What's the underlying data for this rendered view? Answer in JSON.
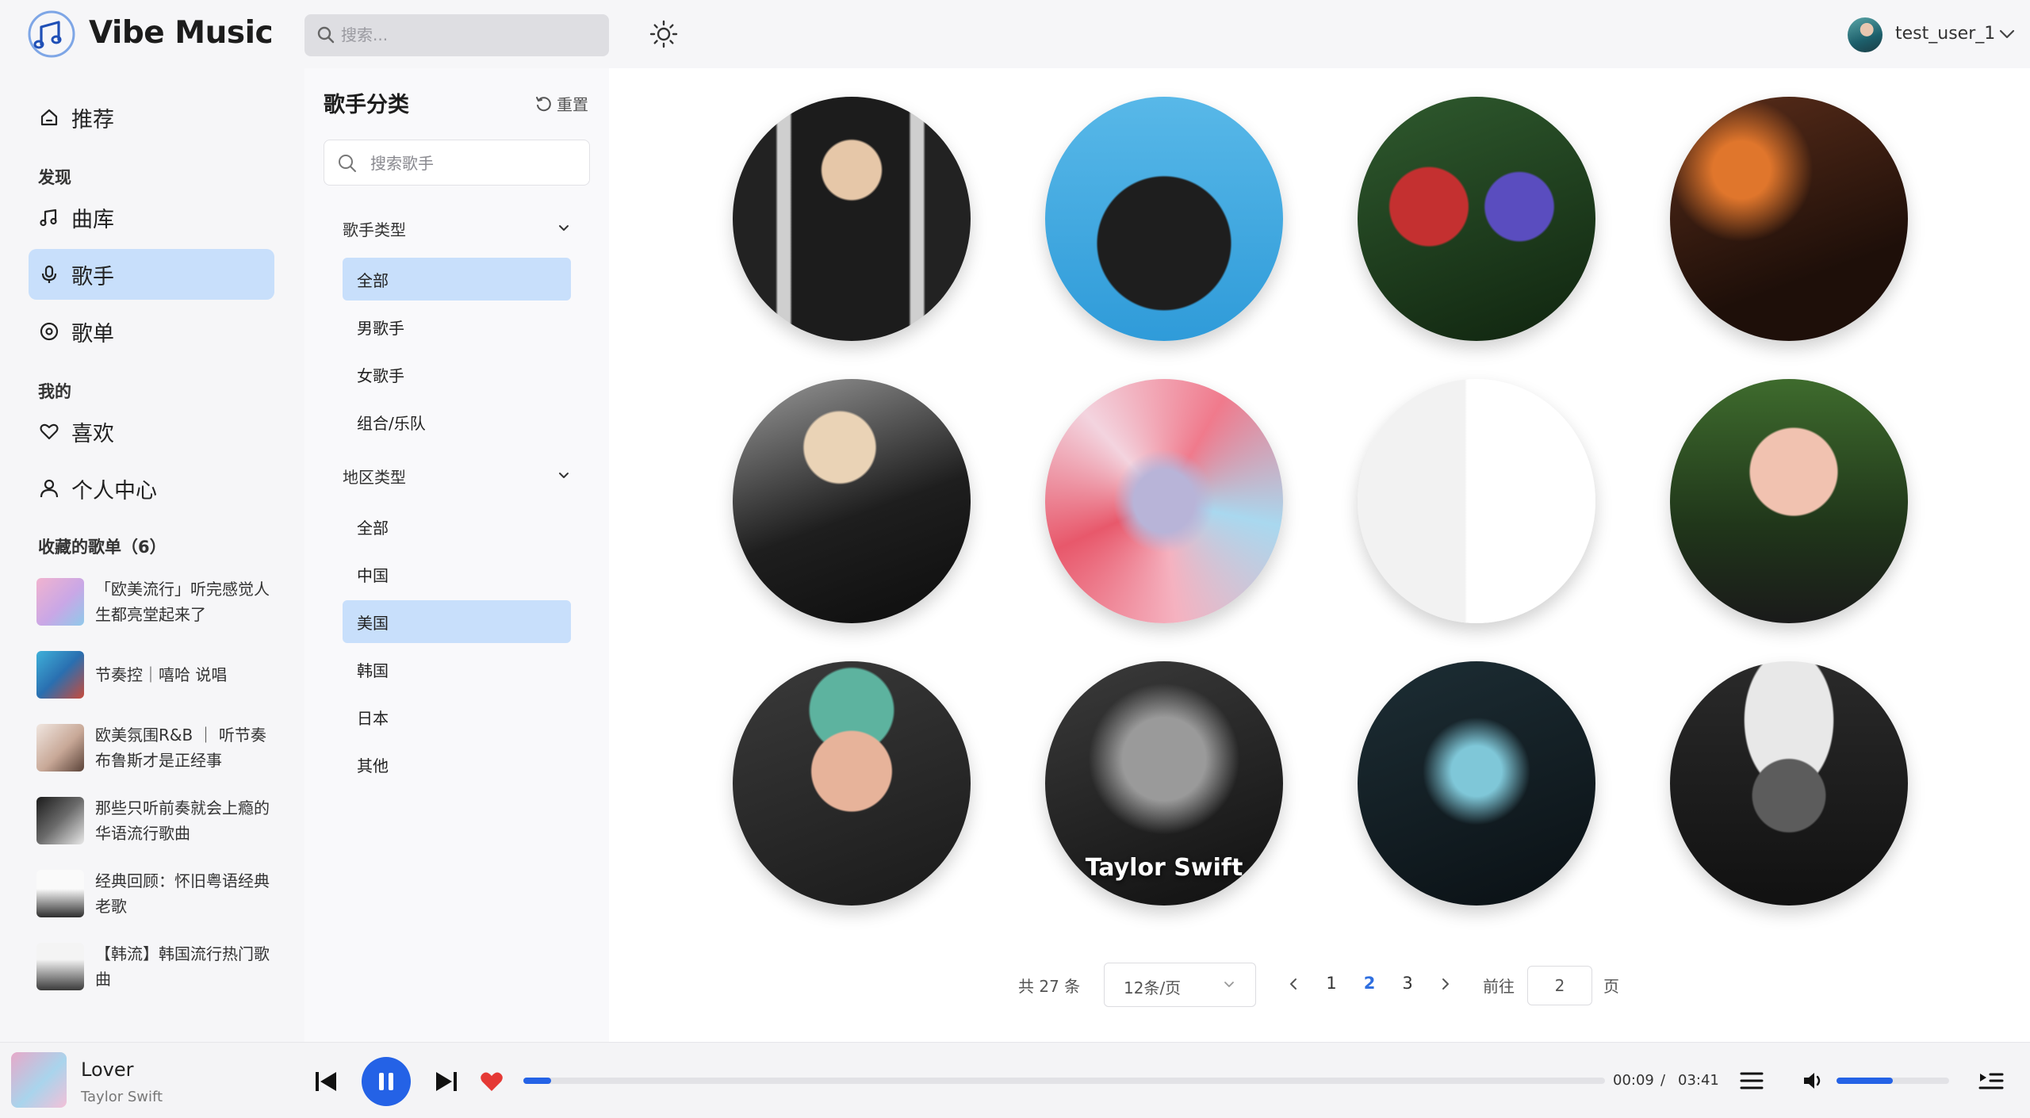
{
  "header": {
    "app_name": "Vibe Music",
    "search_placeholder": "搜索...",
    "user_name": "test_user_1"
  },
  "sidebar": {
    "recommend": "推荐",
    "discover_label": "发现",
    "library": "曲库",
    "artists": "歌手",
    "playlists": "歌单",
    "mine_label": "我的",
    "likes": "喜欢",
    "profile": "个人中心",
    "favorites_label": "收藏的歌单（6）",
    "favorites": [
      {
        "title": "「欧美流行」听完感觉人生都亮堂起来了"
      },
      {
        "title": "节奏控｜嘻哈 说唱"
      },
      {
        "title": "欧美氛围R&B ｜ 听节奏布鲁斯才是正经事"
      },
      {
        "title": "那些只听前奏就会上瘾的华语流行歌曲"
      },
      {
        "title": "经典回顾：怀旧粤语经典老歌"
      },
      {
        "title": "【韩流】韩国流行热门歌曲"
      }
    ]
  },
  "categories": {
    "title": "歌手分类",
    "reset": "重置",
    "search_placeholder": "搜索歌手",
    "type_group": "歌手类型",
    "type_options": [
      "全部",
      "男歌手",
      "女歌手",
      "组合/乐队"
    ],
    "type_selected": "全部",
    "region_group": "地区类型",
    "region_options": [
      "全部",
      "中国",
      "美国",
      "韩国",
      "日本",
      "其他"
    ],
    "region_selected": "美国"
  },
  "artists": [
    {
      "label": ""
    },
    {
      "label": ""
    },
    {
      "label": ""
    },
    {
      "label": ""
    },
    {
      "label": ""
    },
    {
      "label": ""
    },
    {
      "label": ""
    },
    {
      "label": ""
    },
    {
      "label": ""
    },
    {
      "label": "Taylor Swift"
    },
    {
      "label": ""
    },
    {
      "label": ""
    }
  ],
  "pagination": {
    "total": "共 27 条",
    "page_size": "12条/页",
    "pages": [
      "1",
      "2",
      "3"
    ],
    "current_page": "2",
    "goto_label": "前往",
    "goto_value": "2",
    "page_suffix": "页"
  },
  "player": {
    "title": "Lover",
    "artist": "Taylor Swift",
    "current_time": "00:09",
    "separator": "/",
    "duration": "03:41",
    "progress": 0.026,
    "volume": 0.5,
    "liked": true
  },
  "colors": {
    "accent": "#2462e6",
    "active_bg": "#c8dffb",
    "like": "#e53935"
  }
}
